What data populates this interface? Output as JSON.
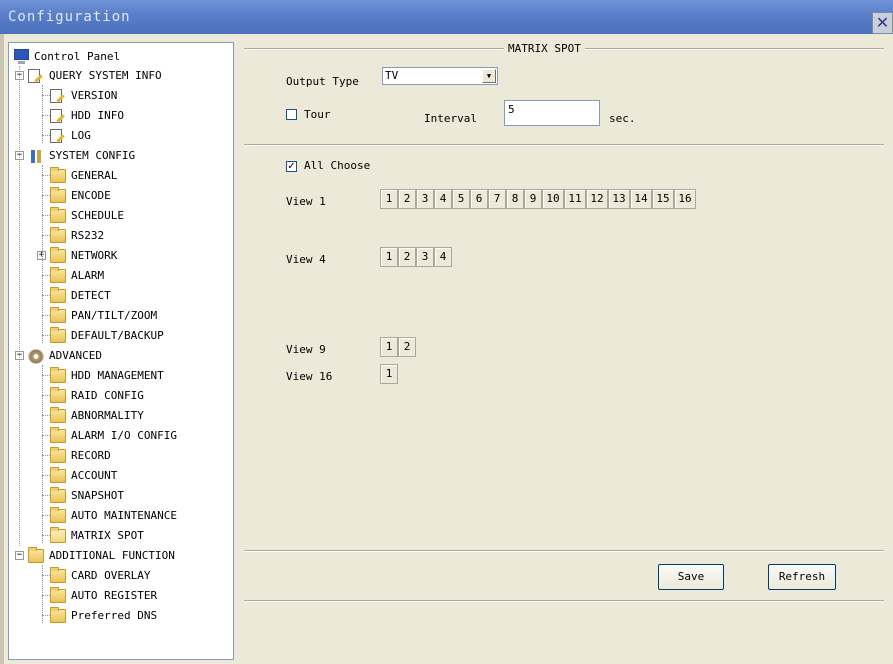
{
  "window": {
    "title": "Configuration",
    "close_glyph": "✕"
  },
  "tree": {
    "root": "Control Panel",
    "items": [
      {
        "label": "QUERY SYSTEM INFO",
        "icon": "document-edit-icon"
      },
      {
        "label": "VERSION",
        "icon": "document-edit-icon"
      },
      {
        "label": "HDD INFO",
        "icon": "document-edit-icon"
      },
      {
        "label": "LOG",
        "icon": "document-edit-icon"
      },
      {
        "label": "SYSTEM CONFIG",
        "icon": "tools-icon"
      },
      {
        "label": "GENERAL",
        "icon": "folder-icon"
      },
      {
        "label": "ENCODE",
        "icon": "folder-icon"
      },
      {
        "label": "SCHEDULE",
        "icon": "folder-icon"
      },
      {
        "label": "RS232",
        "icon": "folder-icon"
      },
      {
        "label": "NETWORK",
        "icon": "folder-icon"
      },
      {
        "label": "ALARM",
        "icon": "folder-icon"
      },
      {
        "label": "DETECT",
        "icon": "folder-icon"
      },
      {
        "label": "PAN/TILT/ZOOM",
        "icon": "folder-icon"
      },
      {
        "label": "DEFAULT/BACKUP",
        "icon": "folder-icon"
      },
      {
        "label": "ADVANCED",
        "icon": "gears-icon"
      },
      {
        "label": "HDD MANAGEMENT",
        "icon": "folder-icon"
      },
      {
        "label": "RAID CONFIG",
        "icon": "folder-icon"
      },
      {
        "label": "ABNORMALITY",
        "icon": "folder-icon"
      },
      {
        "label": "ALARM I/O CONFIG",
        "icon": "folder-icon"
      },
      {
        "label": "RECORD",
        "icon": "folder-icon"
      },
      {
        "label": "ACCOUNT",
        "icon": "folder-icon"
      },
      {
        "label": "SNAPSHOT",
        "icon": "folder-icon"
      },
      {
        "label": "AUTO MAINTENANCE",
        "icon": "folder-icon"
      },
      {
        "label": "MATRIX SPOT",
        "icon": "folder-open-icon",
        "selected": true
      },
      {
        "label": "ADDITIONAL FUNCTION",
        "icon": "folder-icon"
      },
      {
        "label": "CARD OVERLAY",
        "icon": "folder-icon"
      },
      {
        "label": "AUTO REGISTER",
        "icon": "folder-icon"
      },
      {
        "label": "Preferred DNS",
        "icon": "folder-icon"
      }
    ],
    "expander_minus": "−",
    "expander_plus": "+"
  },
  "panel": {
    "group_title": "MATRIX SPOT",
    "output_type_label": "Output Type",
    "output_type_value": "TV",
    "tour_label": "Tour",
    "tour_checked": false,
    "interval_label": "Interval",
    "interval_value": "5",
    "interval_unit": "sec.",
    "all_choose_label": "All Choose",
    "all_choose_checked": true,
    "check_glyph": "✓",
    "views": [
      {
        "label": "View 1",
        "channels": [
          "1",
          "2",
          "3",
          "4",
          "5",
          "6",
          "7",
          "8",
          "9",
          "10",
          "11",
          "12",
          "13",
          "14",
          "15",
          "16"
        ]
      },
      {
        "label": "View 4",
        "channels": [
          "1",
          "2",
          "3",
          "4"
        ]
      },
      {
        "label": "View 9",
        "channels": [
          "1",
          "2"
        ]
      },
      {
        "label": "View 16",
        "channels": [
          "1"
        ]
      }
    ],
    "save_label": "Save",
    "refresh_label": "Refresh"
  },
  "colors": {
    "titlebar": "#5b80c9",
    "window_bg": "#ece9d8",
    "border_blue": "#7f9db9"
  }
}
